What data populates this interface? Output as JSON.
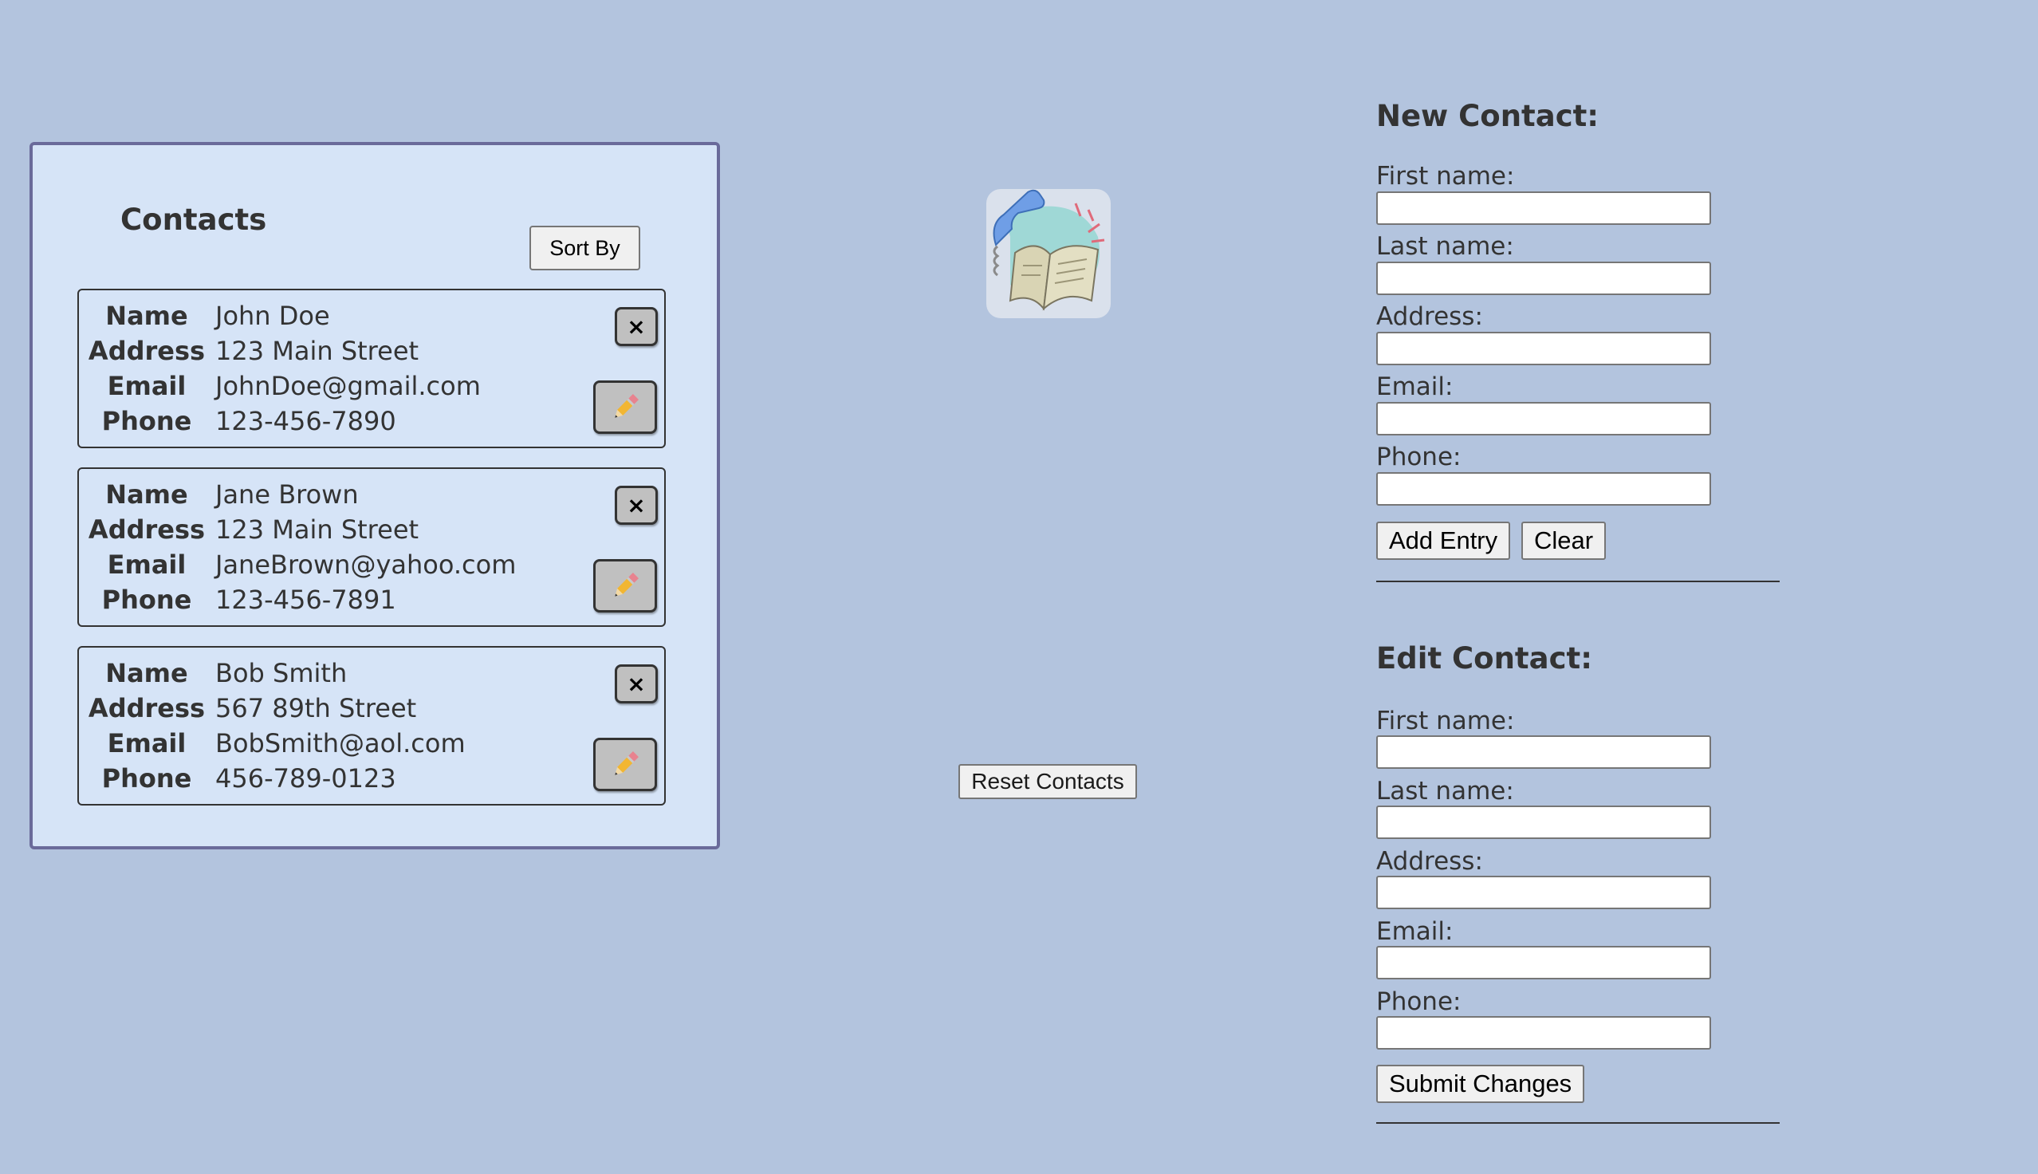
{
  "contacts": {
    "title": "Contacts",
    "sort_label": "Sort By",
    "row_labels": {
      "name": "Name",
      "address": "Address",
      "email": "Email",
      "phone": "Phone"
    },
    "delete_symbol": "×",
    "items": [
      {
        "name": "John Doe",
        "address": "123 Main Street",
        "email": "JohnDoe@gmail.com",
        "phone": "123-456-7890"
      },
      {
        "name": "Jane Brown",
        "address": "123 Main Street",
        "email": "JaneBrown@yahoo.com",
        "phone": "123-456-7891"
      },
      {
        "name": "Bob Smith",
        "address": "567 89th Street",
        "email": "BobSmith@aol.com",
        "phone": "456-789-0123"
      }
    ]
  },
  "center": {
    "logo_icon": "phonebook-icon",
    "reset_label": "Reset Contacts"
  },
  "new_contact": {
    "heading": "New Contact:",
    "fields": {
      "first_name": {
        "label": "First name:",
        "value": ""
      },
      "last_name": {
        "label": "Last name:",
        "value": ""
      },
      "address": {
        "label": "Address:",
        "value": ""
      },
      "email": {
        "label": "Email:",
        "value": ""
      },
      "phone": {
        "label": "Phone:",
        "value": ""
      }
    },
    "add_label": "Add Entry",
    "clear_label": "Clear"
  },
  "edit_contact": {
    "heading": "Edit Contact:",
    "fields": {
      "first_name": {
        "label": "First name:",
        "value": ""
      },
      "last_name": {
        "label": "Last name:",
        "value": ""
      },
      "address": {
        "label": "Address:",
        "value": ""
      },
      "email": {
        "label": "Email:",
        "value": ""
      },
      "phone": {
        "label": "Phone:",
        "value": ""
      }
    },
    "submit_label": "Submit Changes"
  },
  "colors": {
    "page_background": "#b3c4de",
    "panel_background": "#d6e4f7",
    "panel_border": "#6a6a9a",
    "text": "#333333",
    "icon_button": "#c0c0c0"
  }
}
